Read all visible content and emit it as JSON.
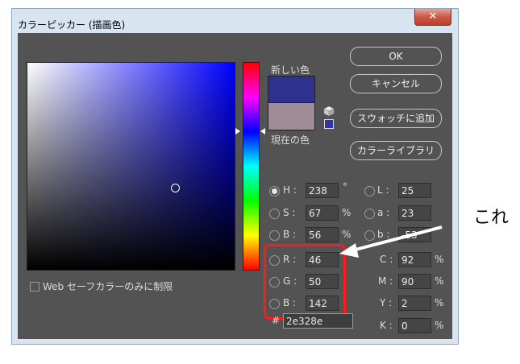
{
  "window": {
    "title": "カラーピッカー (描画色)",
    "close_label": "✕"
  },
  "labels": {
    "new": "新しい色",
    "current": "現在の色"
  },
  "colors": {
    "new_swatch": "#2e328e",
    "current_swatch": "#a08c96",
    "highlight": "#ff1a1a"
  },
  "buttons": {
    "ok": "OK",
    "cancel": "キャンセル",
    "add_swatch": "スウォッチに追加",
    "libraries": "カラーライブラリ"
  },
  "hsb": {
    "h_label": "H :",
    "h": "238",
    "h_unit": "°",
    "s_label": "S :",
    "s": "67",
    "s_unit": "%",
    "b_label": "B :",
    "b": "56",
    "b_unit": "%"
  },
  "lab": {
    "l_label": "L :",
    "l": "25",
    "a_label": "a :",
    "a": "23",
    "b_label": "b :",
    "b": "-53"
  },
  "rgb": {
    "r_label": "R :",
    "r": "46",
    "g_label": "G :",
    "g": "50",
    "b_label": "B :",
    "b": "142"
  },
  "cmyk": {
    "c_label": "C :",
    "c": "92",
    "m_label": "M :",
    "m": "90",
    "y_label": "Y :",
    "y": "2",
    "k_label": "K :",
    "k": "0",
    "unit": "%"
  },
  "hex": {
    "label": "#",
    "value": "2e328e"
  },
  "web_safe_label": "Web セーフカラーのみに制限",
  "annotation": "これ"
}
